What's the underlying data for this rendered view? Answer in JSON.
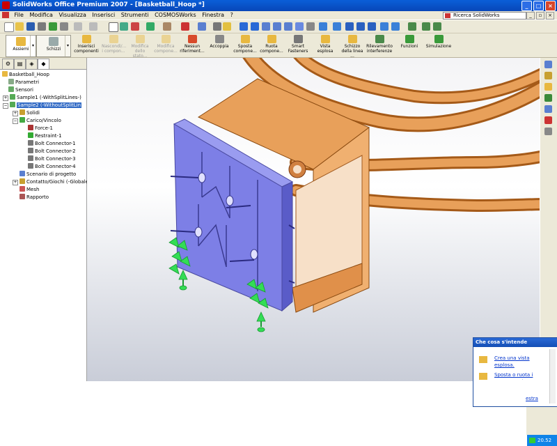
{
  "window": {
    "title": "SolidWorks Office Premium 2007 - [Basketball_Hoop *]"
  },
  "menu": {
    "items": [
      "File",
      "Modifica",
      "Visualizza",
      "Inserisci",
      "Strumenti",
      "COSMOSWorks",
      "Finestra",
      "?"
    ],
    "search_text": "Ricerca SolidWorks"
  },
  "toolbar": {
    "command_manager": {
      "assiemi": "Assiemi",
      "schizzi": "Schizzi"
    },
    "buttons": [
      {
        "label": "Inserisci componenti",
        "enabled": true
      },
      {
        "label": "Nascondi/... i compon...",
        "enabled": false
      },
      {
        "label": "Modifica dello stato...",
        "enabled": false
      },
      {
        "label": "Modifica compone...",
        "enabled": false
      },
      {
        "label": "Nessun riferiment...",
        "enabled": true
      },
      {
        "label": "Accoppia",
        "enabled": true
      },
      {
        "label": "Sposta compone...",
        "enabled": true
      },
      {
        "label": "Ruota compone...",
        "enabled": true
      },
      {
        "label": "Smart Fasteners",
        "enabled": true
      },
      {
        "label": "Vista esplosa",
        "enabled": true
      },
      {
        "label": "Schizzo della linea ...",
        "enabled": true
      },
      {
        "label": "Rilevamento interferenze",
        "enabled": true
      },
      {
        "label": "Funzioni",
        "enabled": true
      },
      {
        "label": "Simulazione",
        "enabled": true
      }
    ]
  },
  "tree": {
    "nodes": [
      {
        "label": "Basketball_Hoop",
        "icon": "assembly-icon",
        "selected": false
      },
      {
        "label": "Parametri",
        "icon": "parameters-icon",
        "selected": false
      },
      {
        "label": "Sensori",
        "icon": "sensor-icon",
        "selected": false
      },
      {
        "label": "Sample1 (-WithSplitLines-)",
        "icon": "study-icon",
        "selected": false
      },
      {
        "label": "Sample2 (-WithoutSplitLin",
        "icon": "study-icon",
        "selected": true
      },
      {
        "label": "Solidi",
        "icon": "solids-icon",
        "selected": false
      },
      {
        "label": "Carico/Vincolo",
        "icon": "load-restraint-icon",
        "selected": false
      },
      {
        "label": "Force-1",
        "icon": "force-icon",
        "selected": false
      },
      {
        "label": "Restraint-1",
        "icon": "restraint-icon",
        "selected": false
      },
      {
        "label": "Bolt Connector-1",
        "icon": "bolt-icon",
        "selected": false
      },
      {
        "label": "Bolt Connector-2",
        "icon": "bolt-icon",
        "selected": false
      },
      {
        "label": "Bolt Connector-3",
        "icon": "bolt-icon",
        "selected": false
      },
      {
        "label": "Bolt Connector-4",
        "icon": "bolt-icon",
        "selected": false
      },
      {
        "label": "Scenario di progetto",
        "icon": "scenario-icon",
        "selected": false
      },
      {
        "label": "Contatto/Giochi (-Globale:",
        "icon": "contact-icon",
        "selected": false
      },
      {
        "label": "Mesh",
        "icon": "mesh-icon",
        "selected": false
      },
      {
        "label": "Rapporto",
        "icon": "report-icon",
        "selected": false
      }
    ]
  },
  "help_panel": {
    "title": "Che cosa s'intende realizzare?",
    "links": [
      "Crea una vista esplosa.",
      "Sposta o ruota i componenti."
    ],
    "partial_link": "estra"
  },
  "taskbar": {
    "time": "20.52"
  },
  "colors": {
    "title_blue": "#0a5fd8",
    "plate": "#7d7fe6",
    "bracket": "#e8a05a",
    "arrows": "#33dd55",
    "selection": "#316ac5"
  }
}
